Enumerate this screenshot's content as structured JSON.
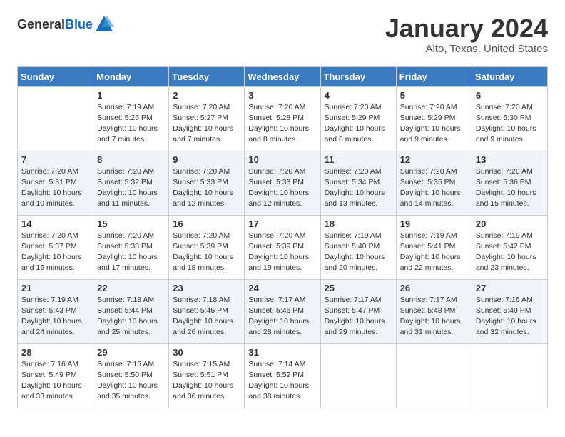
{
  "header": {
    "logo_general": "General",
    "logo_blue": "Blue",
    "title": "January 2024",
    "subtitle": "Alto, Texas, United States"
  },
  "days_of_week": [
    "Sunday",
    "Monday",
    "Tuesday",
    "Wednesday",
    "Thursday",
    "Friday",
    "Saturday"
  ],
  "weeks": [
    [
      {
        "num": "",
        "empty": true
      },
      {
        "num": "1",
        "sunrise": "Sunrise: 7:19 AM",
        "sunset": "Sunset: 5:26 PM",
        "daylight": "Daylight: 10 hours and 7 minutes."
      },
      {
        "num": "2",
        "sunrise": "Sunrise: 7:20 AM",
        "sunset": "Sunset: 5:27 PM",
        "daylight": "Daylight: 10 hours and 7 minutes."
      },
      {
        "num": "3",
        "sunrise": "Sunrise: 7:20 AM",
        "sunset": "Sunset: 5:28 PM",
        "daylight": "Daylight: 10 hours and 8 minutes."
      },
      {
        "num": "4",
        "sunrise": "Sunrise: 7:20 AM",
        "sunset": "Sunset: 5:29 PM",
        "daylight": "Daylight: 10 hours and 8 minutes."
      },
      {
        "num": "5",
        "sunrise": "Sunrise: 7:20 AM",
        "sunset": "Sunset: 5:29 PM",
        "daylight": "Daylight: 10 hours and 9 minutes."
      },
      {
        "num": "6",
        "sunrise": "Sunrise: 7:20 AM",
        "sunset": "Sunset: 5:30 PM",
        "daylight": "Daylight: 10 hours and 9 minutes."
      }
    ],
    [
      {
        "num": "7",
        "sunrise": "Sunrise: 7:20 AM",
        "sunset": "Sunset: 5:31 PM",
        "daylight": "Daylight: 10 hours and 10 minutes."
      },
      {
        "num": "8",
        "sunrise": "Sunrise: 7:20 AM",
        "sunset": "Sunset: 5:32 PM",
        "daylight": "Daylight: 10 hours and 11 minutes."
      },
      {
        "num": "9",
        "sunrise": "Sunrise: 7:20 AM",
        "sunset": "Sunset: 5:33 PM",
        "daylight": "Daylight: 10 hours and 12 minutes."
      },
      {
        "num": "10",
        "sunrise": "Sunrise: 7:20 AM",
        "sunset": "Sunset: 5:33 PM",
        "daylight": "Daylight: 10 hours and 12 minutes."
      },
      {
        "num": "11",
        "sunrise": "Sunrise: 7:20 AM",
        "sunset": "Sunset: 5:34 PM",
        "daylight": "Daylight: 10 hours and 13 minutes."
      },
      {
        "num": "12",
        "sunrise": "Sunrise: 7:20 AM",
        "sunset": "Sunset: 5:35 PM",
        "daylight": "Daylight: 10 hours and 14 minutes."
      },
      {
        "num": "13",
        "sunrise": "Sunrise: 7:20 AM",
        "sunset": "Sunset: 5:36 PM",
        "daylight": "Daylight: 10 hours and 15 minutes."
      }
    ],
    [
      {
        "num": "14",
        "sunrise": "Sunrise: 7:20 AM",
        "sunset": "Sunset: 5:37 PM",
        "daylight": "Daylight: 10 hours and 16 minutes."
      },
      {
        "num": "15",
        "sunrise": "Sunrise: 7:20 AM",
        "sunset": "Sunset: 5:38 PM",
        "daylight": "Daylight: 10 hours and 17 minutes."
      },
      {
        "num": "16",
        "sunrise": "Sunrise: 7:20 AM",
        "sunset": "Sunset: 5:39 PM",
        "daylight": "Daylight: 10 hours and 18 minutes."
      },
      {
        "num": "17",
        "sunrise": "Sunrise: 7:20 AM",
        "sunset": "Sunset: 5:39 PM",
        "daylight": "Daylight: 10 hours and 19 minutes."
      },
      {
        "num": "18",
        "sunrise": "Sunrise: 7:19 AM",
        "sunset": "Sunset: 5:40 PM",
        "daylight": "Daylight: 10 hours and 20 minutes."
      },
      {
        "num": "19",
        "sunrise": "Sunrise: 7:19 AM",
        "sunset": "Sunset: 5:41 PM",
        "daylight": "Daylight: 10 hours and 22 minutes."
      },
      {
        "num": "20",
        "sunrise": "Sunrise: 7:19 AM",
        "sunset": "Sunset: 5:42 PM",
        "daylight": "Daylight: 10 hours and 23 minutes."
      }
    ],
    [
      {
        "num": "21",
        "sunrise": "Sunrise: 7:19 AM",
        "sunset": "Sunset: 5:43 PM",
        "daylight": "Daylight: 10 hours and 24 minutes."
      },
      {
        "num": "22",
        "sunrise": "Sunrise: 7:18 AM",
        "sunset": "Sunset: 5:44 PM",
        "daylight": "Daylight: 10 hours and 25 minutes."
      },
      {
        "num": "23",
        "sunrise": "Sunrise: 7:18 AM",
        "sunset": "Sunset: 5:45 PM",
        "daylight": "Daylight: 10 hours and 26 minutes."
      },
      {
        "num": "24",
        "sunrise": "Sunrise: 7:17 AM",
        "sunset": "Sunset: 5:46 PM",
        "daylight": "Daylight: 10 hours and 28 minutes."
      },
      {
        "num": "25",
        "sunrise": "Sunrise: 7:17 AM",
        "sunset": "Sunset: 5:47 PM",
        "daylight": "Daylight: 10 hours and 29 minutes."
      },
      {
        "num": "26",
        "sunrise": "Sunrise: 7:17 AM",
        "sunset": "Sunset: 5:48 PM",
        "daylight": "Daylight: 10 hours and 31 minutes."
      },
      {
        "num": "27",
        "sunrise": "Sunrise: 7:16 AM",
        "sunset": "Sunset: 5:49 PM",
        "daylight": "Daylight: 10 hours and 32 minutes."
      }
    ],
    [
      {
        "num": "28",
        "sunrise": "Sunrise: 7:16 AM",
        "sunset": "Sunset: 5:49 PM",
        "daylight": "Daylight: 10 hours and 33 minutes."
      },
      {
        "num": "29",
        "sunrise": "Sunrise: 7:15 AM",
        "sunset": "Sunset: 5:50 PM",
        "daylight": "Daylight: 10 hours and 35 minutes."
      },
      {
        "num": "30",
        "sunrise": "Sunrise: 7:15 AM",
        "sunset": "Sunset: 5:51 PM",
        "daylight": "Daylight: 10 hours and 36 minutes."
      },
      {
        "num": "31",
        "sunrise": "Sunrise: 7:14 AM",
        "sunset": "Sunset: 5:52 PM",
        "daylight": "Daylight: 10 hours and 38 minutes."
      },
      {
        "num": "",
        "empty": true
      },
      {
        "num": "",
        "empty": true
      },
      {
        "num": "",
        "empty": true
      }
    ]
  ]
}
